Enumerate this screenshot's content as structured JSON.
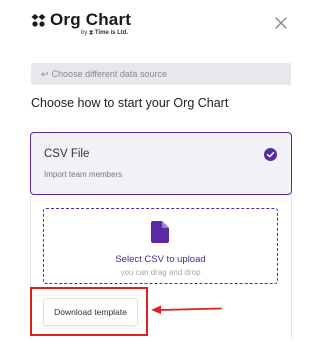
{
  "logo": {
    "title": "Org Chart",
    "byline_prefix": "by",
    "byline_brand": "Time is Ltd.",
    "brand_color": "#1a1a1a"
  },
  "close_icon": "close-icon",
  "back_link": {
    "arrow": "↩",
    "label": "Choose different data source"
  },
  "heading": "Choose how to start your Org Chart",
  "csv_option": {
    "title": "CSV File",
    "subtitle": "Import team members",
    "selected": true,
    "accent_color": "#5a2aa6"
  },
  "upload": {
    "icon": "file-icon",
    "title": "Select CSV to upload",
    "subtitle": "you can drag and drop"
  },
  "download_button": {
    "label": "Download template"
  },
  "annotation": {
    "highlight_color": "#e0201a"
  }
}
